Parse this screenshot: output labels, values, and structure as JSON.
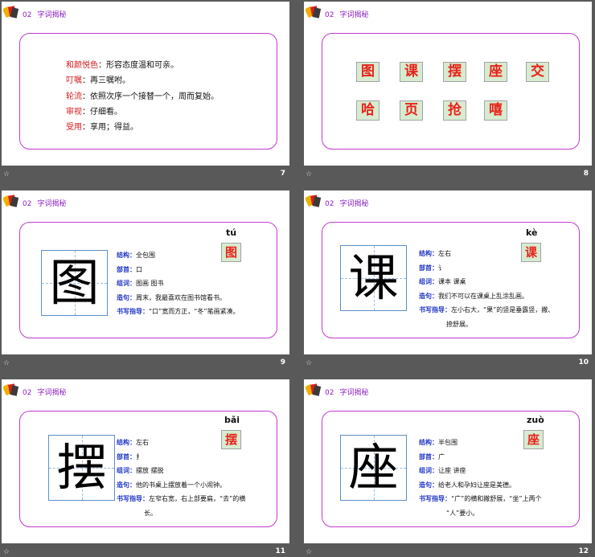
{
  "header": {
    "num": "02",
    "title": "字词揭秘"
  },
  "slide7": {
    "page": "7",
    "defs": [
      {
        "term": "和颜悦色",
        "colon": "：",
        "def": "形容态度温和可亲。"
      },
      {
        "term": "叮嘱",
        "colon": "：",
        "def": "再三嘱咐。"
      },
      {
        "term": "轮流",
        "colon": "：",
        "def": "依照次序一个接替一个，周而复始。"
      },
      {
        "term": "审视",
        "colon": "：",
        "def": "仔细看。"
      },
      {
        "term": "受用",
        "colon": "：",
        "def": "享用；得益。"
      }
    ]
  },
  "slide8": {
    "page": "8",
    "row1": [
      "图",
      "课",
      "摆",
      "座",
      "交"
    ],
    "row2": [
      "哈",
      "页",
      "抢",
      "嘻"
    ]
  },
  "slide9": {
    "page": "9",
    "char": "图",
    "pinyin": "tú",
    "rows": [
      {
        "label": "结构",
        "value": "全包围"
      },
      {
        "label": "部首",
        "value": "口"
      },
      {
        "label": "组词",
        "value": "图画  图书"
      },
      {
        "label": "造句",
        "value": "周末，我最喜欢在图书馆看书。"
      },
      {
        "label": "书写指导",
        "value": "“口”宽而方正，“冬”笔画紧凑。"
      }
    ]
  },
  "slide10": {
    "page": "10",
    "char": "课",
    "pinyin": "kè",
    "rows": [
      {
        "label": "结构",
        "value": "左右"
      },
      {
        "label": "部首",
        "value": "讠"
      },
      {
        "label": "组词",
        "value": "课本  课桌"
      },
      {
        "label": "造句",
        "value": "我们不可以在课桌上乱涂乱画。"
      },
      {
        "label": "书写指导",
        "value": "左小右大，“果”的竖是垂露竖，撇、"
      }
    ],
    "extra": "捺舒展。"
  },
  "slide11": {
    "page": "11",
    "char": "摆",
    "pinyin": "bǎi",
    "rows": [
      {
        "label": "结构",
        "value": "左右"
      },
      {
        "label": "部首",
        "value": "扌"
      },
      {
        "label": "组词",
        "value": "摆放   摆脱"
      },
      {
        "label": "造句",
        "value": "他的书桌上摆放着一个小闹钟。"
      },
      {
        "label": "书写指导",
        "value": "左窄右宽，右上部要扁，“去”的横"
      }
    ],
    "extra": "长。"
  },
  "slide12": {
    "page": "12",
    "char": "座",
    "pinyin": "zuò",
    "rows": [
      {
        "label": "结构",
        "value": "半包围"
      },
      {
        "label": "部首",
        "value": "广"
      },
      {
        "label": "组词",
        "value": "让座  讲座"
      },
      {
        "label": "造句",
        "value": "给老人和孕妇让座是美德。"
      },
      {
        "label": "书写指导",
        "value": "“广”的横和撇舒展，“坐”上两个"
      }
    ],
    "extra": "“人”要小。"
  },
  "footer_icon": "star-icon",
  "colors": {
    "frame": "#c23bd0",
    "term": "#d6191c",
    "label": "#2036c4",
    "char": "#e8231a",
    "char_bg": "#d7ebd0"
  }
}
